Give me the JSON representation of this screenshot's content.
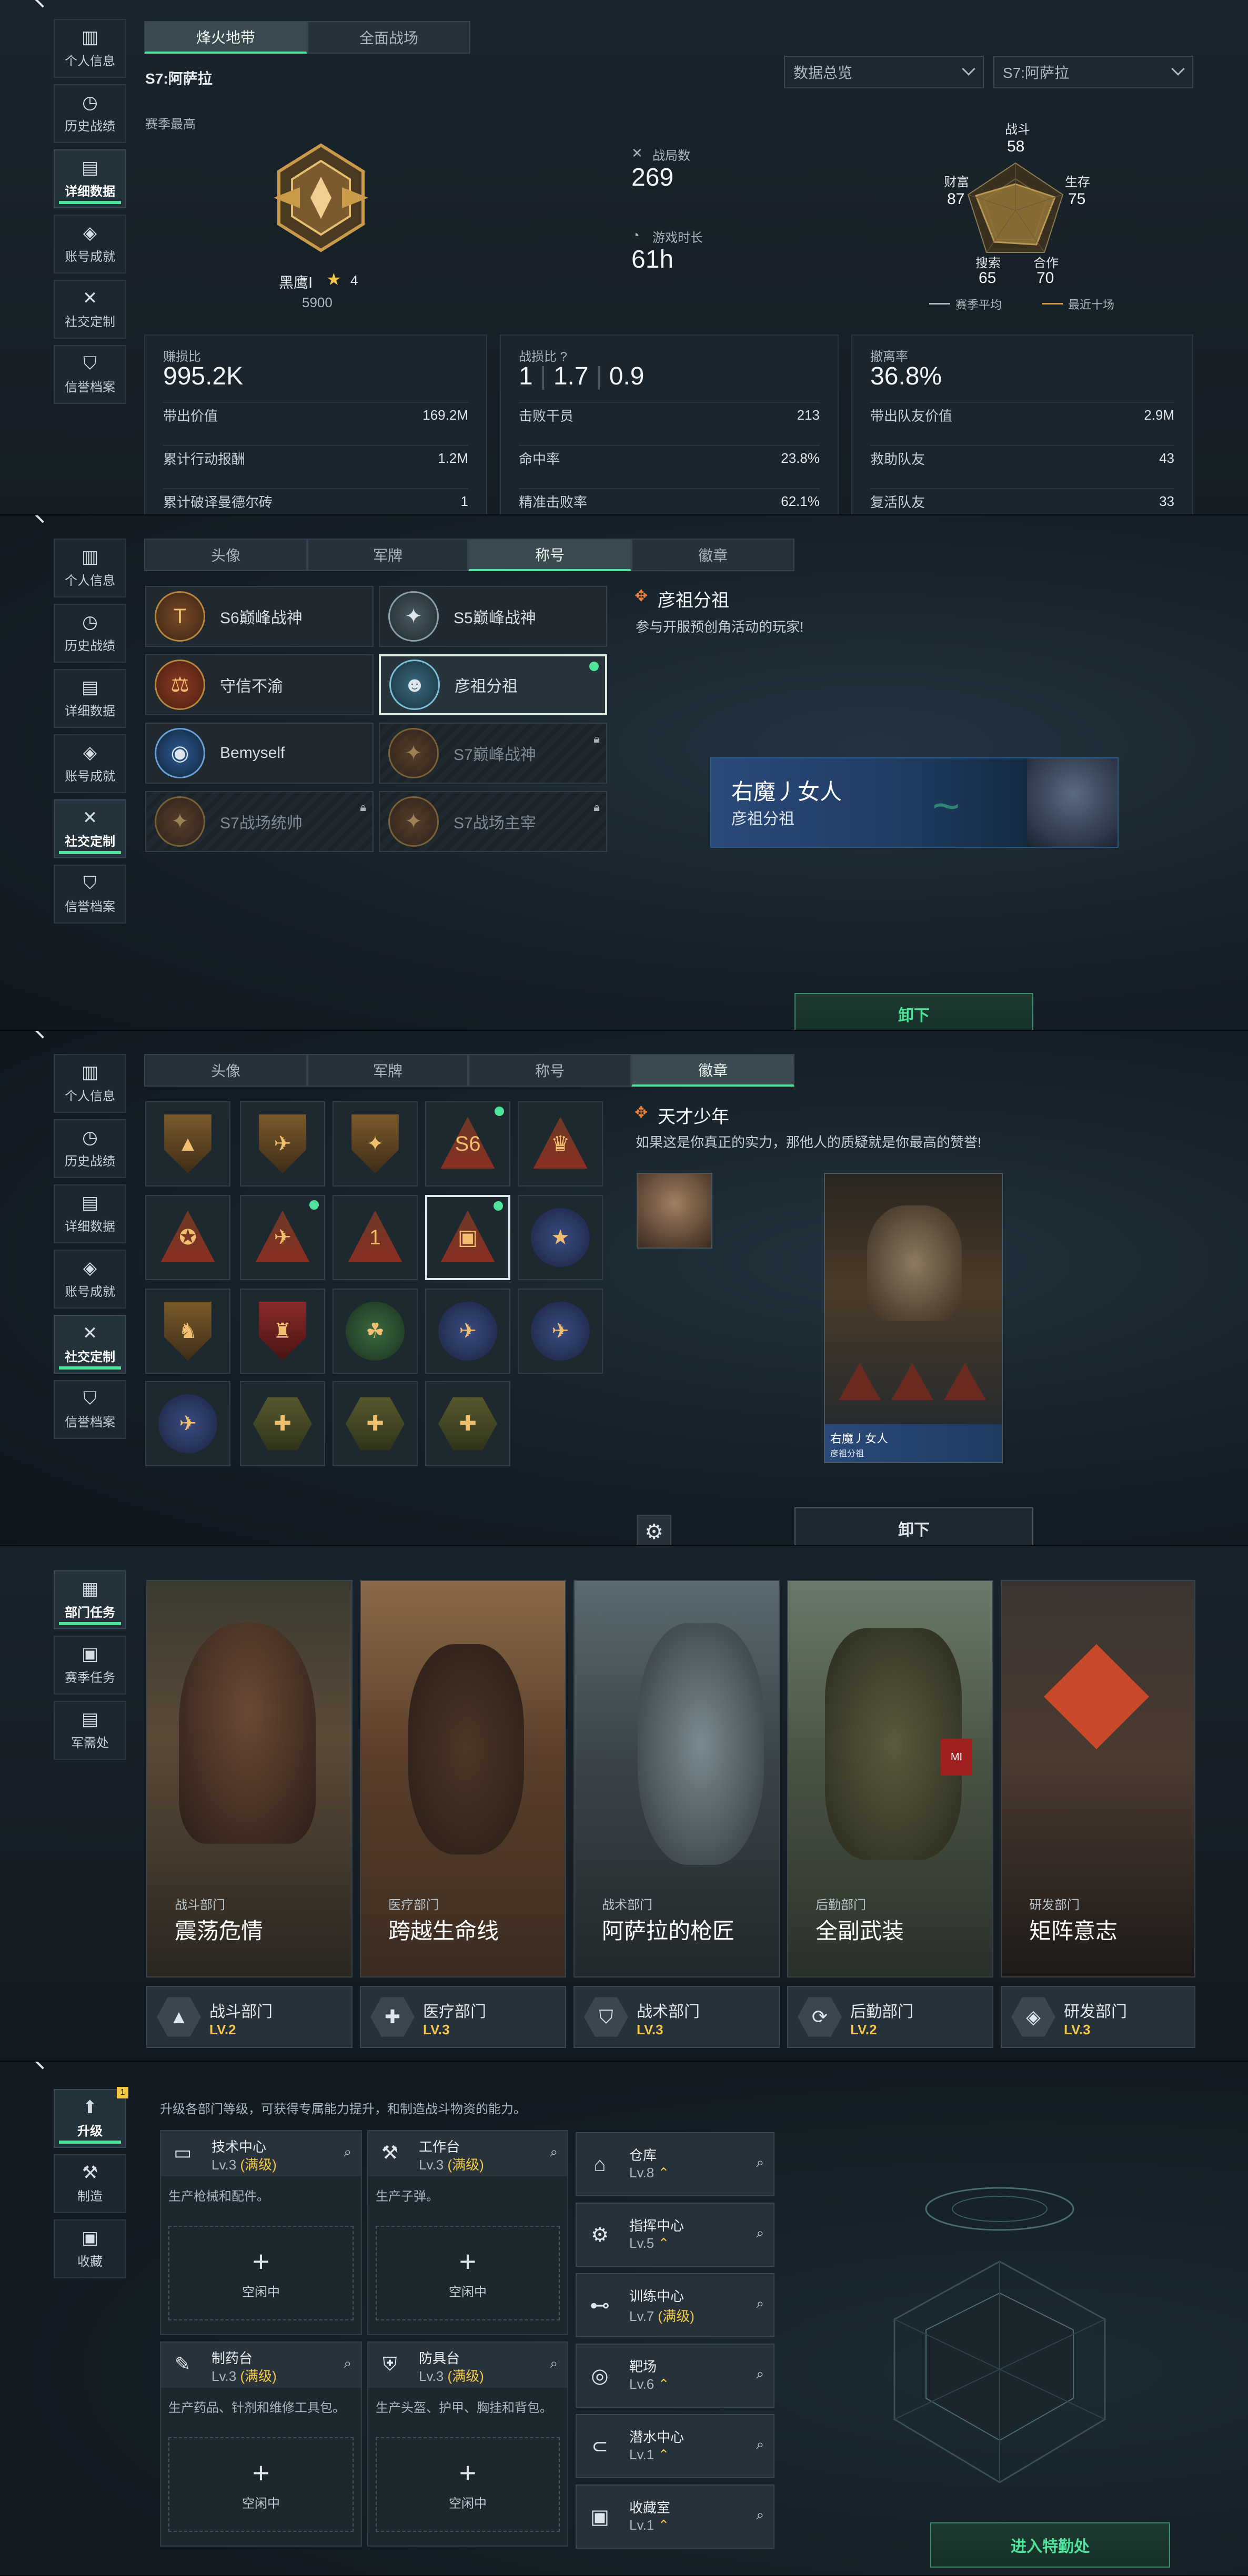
{
  "sidebar_main": {
    "items": [
      {
        "label": "个人信息",
        "icon": "bar-chart-icon"
      },
      {
        "label": "历史战绩",
        "icon": "history-icon"
      },
      {
        "label": "详细数据",
        "icon": "folder-icon"
      },
      {
        "label": "账号成就",
        "icon": "medal-icon"
      },
      {
        "label": "社交定制",
        "icon": "tools-icon"
      },
      {
        "label": "信誉档案",
        "icon": "shield-icon"
      }
    ]
  },
  "p1": {
    "mode_tabs": [
      "烽火地带",
      "全面战场"
    ],
    "season_label": "S7:阿萨拉",
    "filter_scope": "数据总览",
    "filter_season": "S7:阿萨拉",
    "season_best": "赛季最高",
    "rank_name": "黑鹰Ⅰ",
    "rank_stars": "4",
    "rank_points": "5900",
    "battles_label": "战局数",
    "battles_value": "269",
    "time_label": "游戏时长",
    "time_value": "61h",
    "radar": {
      "combat_label": "战斗",
      "combat": "58",
      "wealth_label": "财富",
      "wealth": "87",
      "survive_label": "生存",
      "survive": "75",
      "search_label": "搜索",
      "search": "65",
      "coop_label": "合作",
      "coop": "70",
      "legend_season": "赛季平均",
      "legend_recent": "最近十场"
    },
    "card1": {
      "caption": "赚损比",
      "big": "995.2K",
      "rows": [
        {
          "k": "带出价值",
          "v": "169.2M"
        },
        {
          "k": "累计行动报酬",
          "v": "1.2M"
        },
        {
          "k": "累计破译曼德尔砖",
          "v": "1"
        }
      ]
    },
    "card2": {
      "caption": "战损比",
      "big_a": "1",
      "big_b": "1.7",
      "big_c": "0.9",
      "rows": [
        {
          "k": "击败干员",
          "v": "213"
        },
        {
          "k": "命中率",
          "v": "23.8%"
        },
        {
          "k": "精准击败率",
          "v": "62.1%"
        }
      ]
    },
    "card3": {
      "caption": "撤离率",
      "big": "36.8%",
      "rows": [
        {
          "k": "带出队友价值",
          "v": "2.9M"
        },
        {
          "k": "救助队友",
          "v": "43"
        },
        {
          "k": "复活队友",
          "v": "33"
        }
      ]
    }
  },
  "custom_tabs": [
    "头像",
    "军牌",
    "称号",
    "徽章"
  ],
  "p2": {
    "titles": [
      {
        "name": "S6巅峰战神"
      },
      {
        "name": "S5巅峰战神"
      },
      {
        "name": "守信不渝"
      },
      {
        "name": "彦祖分祖"
      },
      {
        "name": "Bemyself"
      },
      {
        "name": "S7巅峰战神"
      },
      {
        "name": "S7战场统帅"
      },
      {
        "name": "S7战场主宰"
      }
    ],
    "detail_title": "彦祖分祖",
    "detail_desc": "参与开服预创角活动的玩家!",
    "preview_name": "右魔丿女人",
    "preview_title": "彦祖分祖",
    "unequip": "卸下"
  },
  "p3": {
    "detail_title": "天才少年",
    "detail_desc": "如果这是你真正的实力，那他人的质疑就是你最高的赞誉!",
    "card_name": "右魔丿女人",
    "card_sub": "彦祖分祖",
    "unequip": "卸下"
  },
  "p4": {
    "sidebar": [
      {
        "label": "部门任务",
        "icon": "task-icon"
      },
      {
        "label": "赛季任务",
        "icon": "season-icon"
      },
      {
        "label": "军需处",
        "icon": "supply-icon"
      }
    ],
    "cards": [
      {
        "cat": "战斗部门",
        "title": "震荡危情",
        "dept": "战斗部门",
        "lv": "LV.2"
      },
      {
        "cat": "医疗部门",
        "title": "跨越生命线",
        "dept": "医疗部门",
        "lv": "LV.3"
      },
      {
        "cat": "战术部门",
        "title": "阿萨拉的枪匠",
        "dept": "战术部门",
        "lv": "LV.3"
      },
      {
        "cat": "后勤部门",
        "title": "全副武装",
        "dept": "后勤部门",
        "lv": "LV.2"
      },
      {
        "cat": "研发部门",
        "title": "矩阵意志",
        "dept": "研发部门",
        "lv": "LV.3"
      }
    ]
  },
  "p5": {
    "sidebar": [
      {
        "label": "升级",
        "icon": "upgrade-icon"
      },
      {
        "label": "制造",
        "icon": "craft-icon"
      },
      {
        "label": "收藏",
        "icon": "collect-icon"
      }
    ],
    "badge_count": "1",
    "intro": "升级各部门等级，可获得专属能力提升，和制造战斗物资的能力。",
    "facilities": [
      {
        "name": "技术中心",
        "lv": "Lv.3",
        "max": "(满级)",
        "desc": "生产枪械和配件。",
        "state": "空闲中"
      },
      {
        "name": "工作台",
        "lv": "Lv.3",
        "max": "(满级)",
        "desc": "生产子弹。",
        "state": "空闲中"
      },
      {
        "name": "制药台",
        "lv": "Lv.3",
        "max": "(满级)",
        "desc": "生产药品、针剂和维修工具包。",
        "state": "空闲中"
      },
      {
        "name": "防具台",
        "lv": "Lv.3",
        "max": "(满级)",
        "desc": "生产头盔、护甲、胸挂和背包。",
        "state": "空闲中"
      }
    ],
    "rooms": [
      {
        "name": "仓库",
        "lv": "Lv.8",
        "up": "⌃"
      },
      {
        "name": "指挥中心",
        "lv": "Lv.5",
        "up": "⌃"
      },
      {
        "name": "训练中心",
        "lv": "Lv.7",
        "up": "(满级)"
      },
      {
        "name": "靶场",
        "lv": "Lv.6",
        "up": "⌃"
      },
      {
        "name": "潜水中心",
        "lv": "Lv.1",
        "up": "⌃"
      },
      {
        "name": "收藏室",
        "lv": "Lv.1",
        "up": "⌃"
      }
    ],
    "enter_btn": "进入特勤处"
  }
}
